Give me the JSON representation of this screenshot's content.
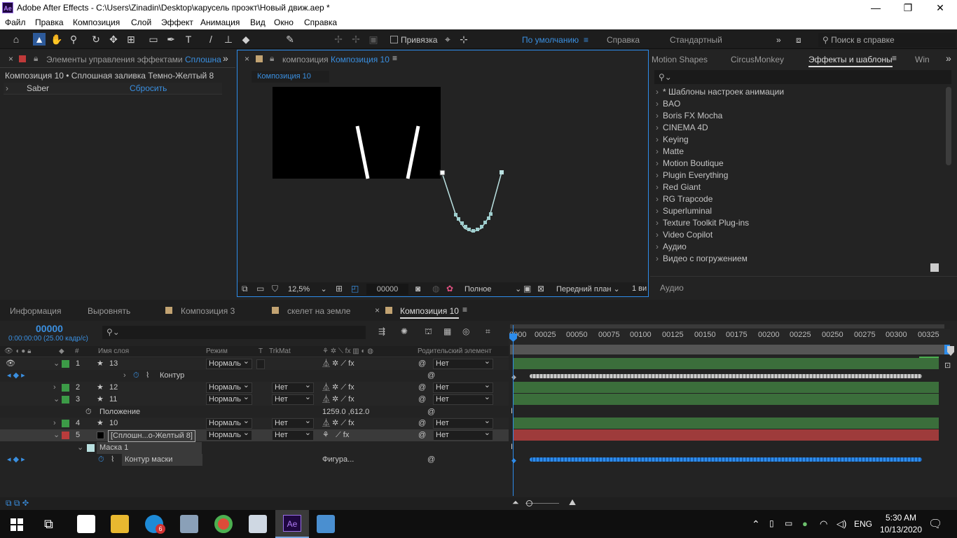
{
  "window": {
    "title": "Adobe After Effects - C:\\Users\\Zinadin\\Desktop\\карусель проэкт\\Новый движ.aep *",
    "app_icon": "Ae",
    "controls": [
      "—",
      "❐",
      "✕"
    ]
  },
  "menu": [
    "Файл",
    "Правка",
    "Композиция",
    "Слой",
    "Эффект",
    "Анимация",
    "Вид",
    "Окно",
    "Справка"
  ],
  "toolbar": {
    "snap_label": "Привязка",
    "workspaces": [
      "По умолчанию",
      "Справка",
      "Стандартный"
    ],
    "search_placeholder": "Поиск в справке"
  },
  "effects_panel": {
    "tab_prefix": "Элементы управления эффектами",
    "tab_layer": "Сплошна",
    "header": "Композиция 10 • Сплошная заливка Темно-Желтый 8",
    "effect_name": "Saber",
    "reset_label": "Сбросить"
  },
  "comp_panel": {
    "tab_prefix": "композиция",
    "tab_name": "Композиция 10",
    "subtab": "Композиция 10",
    "zoom": "12,5%",
    "timecode": "00000",
    "resolution": "Полное",
    "view": "Передний план",
    "views": "1 ви"
  },
  "right_panel": {
    "tabs": [
      "Motion Shapes",
      "CircusMonkey",
      "Эффекты и шаблоны",
      "Win"
    ],
    "items": [
      "* Шаблоны настроек анимации",
      "BAO",
      "Boris FX Mocha",
      "CINEMA 4D",
      "Keying",
      "Matte",
      "Motion Boutique",
      "Plugin Everything",
      "Red Giant",
      "RG Trapcode",
      "Superluminal",
      "Texture Toolkit Plug-ins",
      "Video Copilot",
      "Аудио",
      "Видео с погружением"
    ],
    "audio_label": "Аудио"
  },
  "lower_tabs": [
    "Информация",
    "Выровнять",
    "Композиция 3",
    "скелет на земле",
    "Композиция 10"
  ],
  "timeline": {
    "timecode": "00000",
    "fps_info": "0:00:00:00 (25.00 кадр/с)",
    "columns": {
      "num": "#",
      "name": "Имя слоя",
      "mode": "Режим",
      "t": "T",
      "trkmat": "TrkMat",
      "parent": "Родительский элемент"
    },
    "ruler": [
      "0000",
      "00025",
      "00050",
      "00075",
      "00100",
      "00125",
      "00150",
      "00175",
      "00200",
      "00225",
      "00250",
      "00275",
      "00300",
      "00325"
    ],
    "layers": [
      {
        "num": "1",
        "name": "13",
        "mode": "Нормаль",
        "trk": "",
        "parent": "Нет",
        "color": "#3c9b47"
      },
      {
        "sub": "Контур"
      },
      {
        "num": "2",
        "name": "12",
        "mode": "Нормаль",
        "trk": "Нет",
        "parent": "Нет",
        "color": "#3c9b47"
      },
      {
        "num": "3",
        "name": "11",
        "mode": "Нормаль",
        "trk": "Нет",
        "parent": "Нет",
        "color": "#3c9b47"
      },
      {
        "sub": "Положение",
        "value": "1259.0 ,612.0"
      },
      {
        "num": "4",
        "name": "10",
        "mode": "Нормаль",
        "trk": "Нет",
        "parent": "Нет",
        "color": "#3c9b47"
      },
      {
        "num": "5",
        "name": "[Сплошн...о-Желтый 8]",
        "mode": "Нормаль",
        "trk": "Нет",
        "parent": "Нет",
        "color": "#b83c3c"
      },
      {
        "sub": "Маска 1"
      },
      {
        "sub": "Контур маски",
        "value": "Фигура..."
      }
    ]
  },
  "tray": {
    "lang": "ENG",
    "time": "5:30 AM",
    "date": "10/13/2020",
    "skype_badge": "6"
  },
  "colors": {
    "accent": "#2d8ceb",
    "green_bar": "#3b6e3b",
    "red_bar": "#9e3b3b"
  }
}
